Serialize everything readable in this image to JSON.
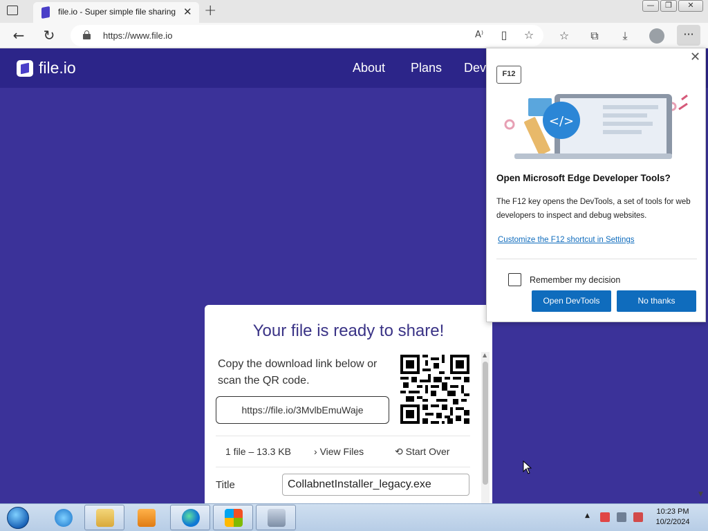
{
  "browser": {
    "tab_title": "file.io - Super simple file sharing",
    "url": "https://www.file.io",
    "window_controls": [
      "—",
      "❐",
      "✕"
    ],
    "toolbar_icons": [
      "read-aloud-icon",
      "immersive-reader-icon",
      "add-favorite-icon",
      "favorites-icon",
      "collections-icon",
      "downloads-icon",
      "profile-icon",
      "more-icon"
    ]
  },
  "site": {
    "logo_text": "file.io",
    "nav": [
      "About",
      "Plans",
      "Dev"
    ],
    "colors": {
      "header": "#2c2589",
      "page": "#3b3299",
      "accent": "#3a3386"
    }
  },
  "share_card": {
    "title": "Your file is ready to share!",
    "description": "Copy the download link below or scan the QR code.",
    "link": "https://file.io/3MvlbEmuWaje",
    "file_info": "1 file – 13.3 KB",
    "view_files": "View Files",
    "start_over": "Start Over",
    "title_label": "Title",
    "title_value": "CollabnetInstaller_legacy.exe"
  },
  "devtools_popup": {
    "key_badge": "F12",
    "heading": "Open Microsoft Edge Developer Tools?",
    "body": "The F12 key opens the DevTools, a set of tools for web developers to inspect and debug websites.",
    "link": "Customize the F12 shortcut in Settings",
    "checkbox_label": "Remember my decision",
    "primary_button": "Open DevTools",
    "secondary_button": "No thanks"
  },
  "taskbar": {
    "time": "10:23 PM",
    "date": "10/2/2024",
    "apps": [
      "internet-explorer-icon",
      "file-explorer-icon",
      "media-player-icon",
      "edge-icon",
      "windows-flag-icon",
      "network-app-icon"
    ]
  }
}
